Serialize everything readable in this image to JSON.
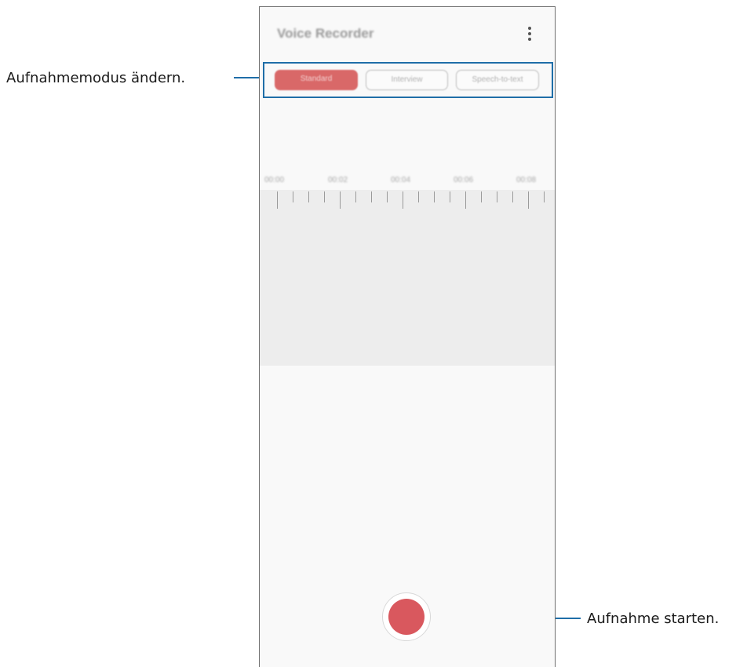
{
  "callouts": {
    "mode_change": "Aufnahmemodus ändern.",
    "start_recording": "Aufnahme starten."
  },
  "app": {
    "title": "Voice Recorder",
    "menu_icon": "more-vertical-icon"
  },
  "modes": {
    "standard": "Standard",
    "interview": "Interview",
    "speech_to_text": "Speech-to-text",
    "selected": "Standard"
  },
  "timeline": {
    "labels": [
      "00:00",
      "00:02",
      "00:04",
      "00:06",
      "00:08"
    ]
  },
  "record": {
    "icon": "record-icon"
  },
  "colors": {
    "accent_red": "#d9585e",
    "callout_blue": "#1f6ea8"
  }
}
